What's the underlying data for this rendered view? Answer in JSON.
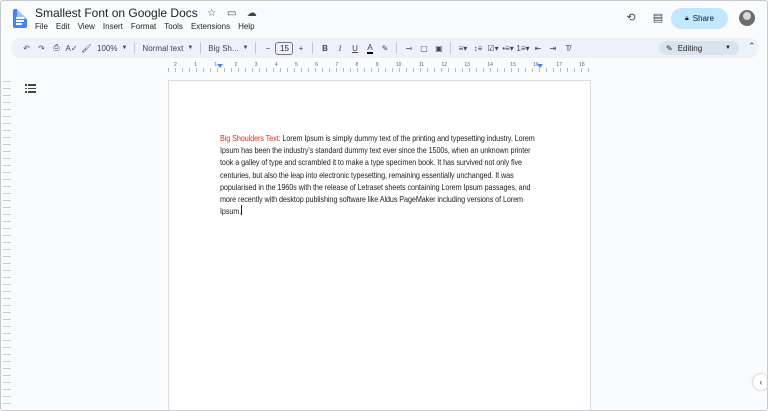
{
  "header": {
    "title": "Smallest Font on Google Docs",
    "menu": [
      "File",
      "Edit",
      "View",
      "Insert",
      "Format",
      "Tools",
      "Extensions",
      "Help"
    ],
    "share_label": "Share"
  },
  "toolbar": {
    "zoom": "100%",
    "style": "Normal text",
    "font": "Big Sh...",
    "font_size": "15",
    "mode": "Editing"
  },
  "ruler": {
    "numbers": [
      "2",
      "1",
      "1",
      "2",
      "3",
      "4",
      "5",
      "6",
      "7",
      "8",
      "9",
      "10",
      "11",
      "12",
      "13",
      "14",
      "15",
      "16",
      "17",
      "18"
    ]
  },
  "document": {
    "lead": "Big Shoulders Text:",
    "body": " Lorem Ipsum is simply dummy text of the printing and typesetting industry. Lorem Ipsum has been the industry's standard dummy text ever since the 1500s, when an unknown printer took a galley of type and scrambled it to make a type specimen book. It has survived not only five centuries, but also the leap into electronic typesetting, remaining essentially unchanged. It was popularised in the 1960s with the release of Letraset sheets containing Lorem Ipsum passages, and more recently with desktop publishing software like Aldus PageMaker including versions of Lorem Ipsum."
  },
  "colors": {
    "accent": "#c2e7ff",
    "lead_text": "#e8291c",
    "toolbar_bg": "#edf2fa"
  }
}
